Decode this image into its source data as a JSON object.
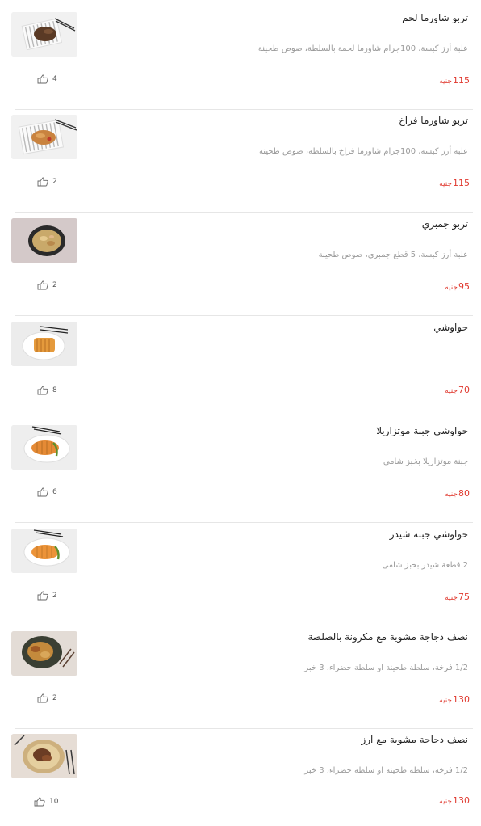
{
  "currency": "جنيه",
  "items": [
    {
      "name": "تربو شاورما لحم",
      "description": "علبة أرز كبسة، 100جرام شاورما لحمة بالسلطة، صوص طحينة",
      "price": "115",
      "likes": "4",
      "image": "plate-striped-meat"
    },
    {
      "name": "تربو شاورما فراخ",
      "description": "علبة أرز كبسة، 100جرام شاورما فراخ بالسلطة، صوص طحينة",
      "price": "115",
      "likes": "2",
      "image": "plate-striped-chicken"
    },
    {
      "name": "تربو جمبري",
      "description": "علبة أرز كبسة، 5 قطع جمبري، صوص طحينة",
      "price": "95",
      "likes": "2",
      "image": "bowl-dark-shrimp"
    },
    {
      "name": "حواوشي",
      "description": "",
      "price": "70",
      "likes": "8",
      "image": "plate-hawawshi"
    },
    {
      "name": "حواوشي جبنة موتزاريلا",
      "description": "جبنة موتزاريلا بخبز شامى",
      "price": "80",
      "likes": "6",
      "image": "plate-hawawshi-mozzarella"
    },
    {
      "name": "حواوشي جبنة شيدر",
      "description": "2 قطعة شيدر بخبز شامى",
      "price": "75",
      "likes": "2",
      "image": "plate-hawawshi-cheddar"
    },
    {
      "name": "نصف دجاجة مشوية مع مكرونة بالصلصة",
      "description": "1/2 فرخة، سلطة طحينة او سلطة خضراء، 3 خبز",
      "price": "130",
      "likes": "2",
      "image": "plate-chicken-pasta"
    },
    {
      "name": "نصف دجاجة مشوية مع ارز",
      "description": "1/2 فرخة، سلطة طحينة او سلطة خضراء، 3 خبز",
      "price": "130",
      "likes": "10",
      "image": "plate-chicken-rice"
    }
  ],
  "icons": {
    "like": "thumbs-up-icon"
  },
  "colors": {
    "price": "#e0392f",
    "text": "#222222",
    "muted": "#9a9a9a"
  }
}
